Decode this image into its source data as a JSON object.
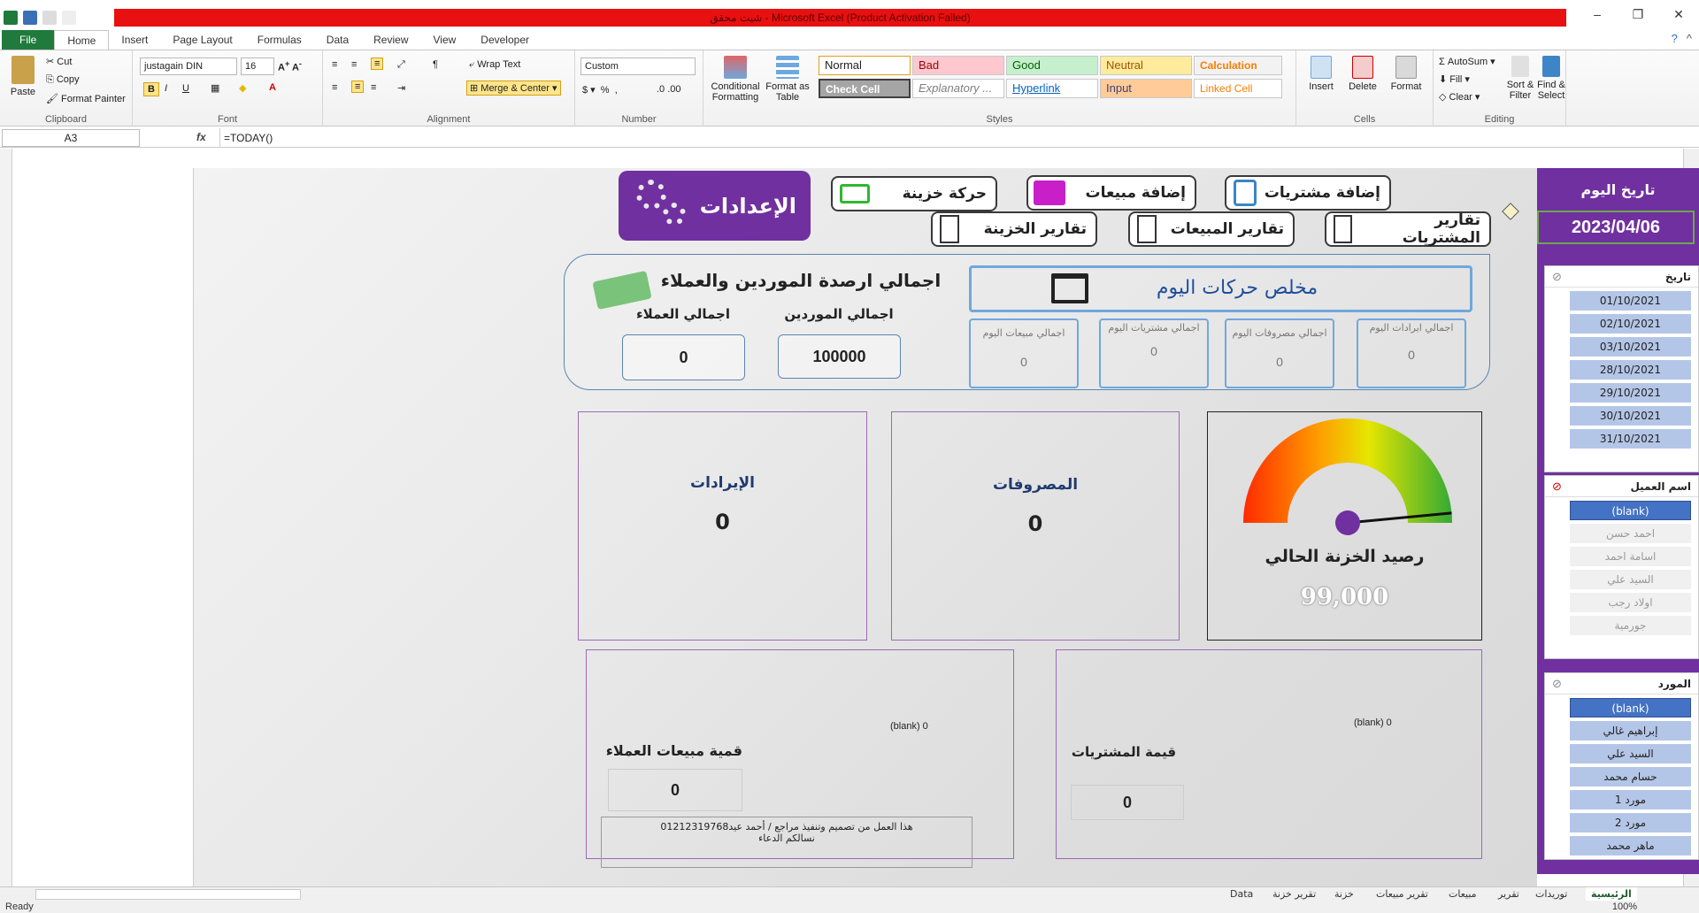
{
  "window": {
    "title": "شيت محقق - Microsoft Excel (Product Activation Failed)"
  },
  "ribbon_tabs": [
    "File",
    "Home",
    "Insert",
    "Page Layout",
    "Formulas",
    "Data",
    "Review",
    "View",
    "Developer"
  ],
  "clipboard": {
    "paste": "Paste",
    "cut": "Cut",
    "copy": "Copy",
    "format_painter": "Format Painter",
    "label": "Clipboard"
  },
  "font": {
    "name": "justagain DIN",
    "size": "16",
    "label": "Font"
  },
  "alignment": {
    "wrap": "Wrap Text",
    "merge": "Merge & Center",
    "label": "Alignment"
  },
  "number": {
    "format": "Custom",
    "label": "Number"
  },
  "styles": {
    "conditional": "Conditional Formatting",
    "format_table": "Format as Table",
    "normal": "Normal",
    "bad": "Bad",
    "good": "Good",
    "neutral": "Neutral",
    "calculation": "Calculation",
    "check_cell": "Check Cell",
    "explanatory": "Explanatory ...",
    "hyperlink": "Hyperlink",
    "input": "Input",
    "linked_cell": "Linked Cell",
    "label": "Styles"
  },
  "cells": {
    "insert": "Insert",
    "delete": "Delete",
    "format": "Format",
    "label": "Cells"
  },
  "editing": {
    "autosum": "AutoSum",
    "fill": "Fill",
    "clear": "Clear",
    "sort": "Sort & Filter",
    "find": "Find & Select",
    "label": "Editing"
  },
  "formula_bar": {
    "name_box": "A3",
    "formula": "=TODAY()"
  },
  "nav": {
    "settings": "الإعدادات",
    "cash_move": "حركة خزينة",
    "add_sales": "إضافة مبيعات",
    "add_purchases": "إضافة مشتريات",
    "treasury_reports": "تقارير الخزينة",
    "sales_reports": "تقارير المبيعات",
    "purchase_reports": "تقارير المشتريات"
  },
  "summary": {
    "balances_title": "اجمالي ارصدة الموردين والعملاء",
    "customers_label": "اجمالي العملاء",
    "suppliers_label": "اجمالي الموردين",
    "customers_value": "0",
    "suppliers_value": "100000",
    "today_title": "مخلص حركات اليوم",
    "today_sales": "اجمالي مبيعات اليوم",
    "today_purchases": "اجمالي مشتريات اليوم",
    "today_expenses": "اجمالي مصروفات اليوم",
    "today_revenues": "اجمالي ايرادات اليوم",
    "today_sales_value": "0",
    "today_purchases_value": "0",
    "today_expenses_value": "0",
    "today_revenues_value": "0"
  },
  "cards": {
    "revenues": "الإيرادات",
    "revenues_value": "0",
    "expenses": "المصروفات",
    "expenses_value": "0",
    "balance_title": "رصيد الخزنة الحالي",
    "balance_value": "99,000",
    "customer_sales": "قمية مبيعات العملاء",
    "customer_sales_value": "0",
    "customer_blank": "(blank) 0",
    "purchases_value_label": "قيمة المشتريات",
    "purchases_value": "0",
    "purchases_blank": "(blank) 0",
    "credit": "هذا العمل من تصميم وتنفيذ مراجع / أحمد عيد01212319768",
    "credit2": "نسالكم الدعاء"
  },
  "gauge": {
    "level": 0.97
  },
  "sidebar": {
    "today_label": "تاريخ اليوم",
    "today_value": "2023/04/06",
    "date_slicer": "تاريخ",
    "dates": [
      "01/10/2021",
      "02/10/2021",
      "03/10/2021",
      "28/10/2021",
      "29/10/2021",
      "30/10/2021",
      "31/10/2021"
    ],
    "customer_slicer": "اسم العميل",
    "customers": [
      "(blank)",
      "احمد حسن",
      "اسامة احمد",
      "السيد علي",
      "اولاد رجب",
      "جورمية"
    ],
    "supplier_slicer": "المورد",
    "suppliers": [
      "(blank)",
      "إبراهيم غالي",
      "السيد علي",
      "حسام محمد",
      "مورد 1",
      "مورد 2",
      "ماهر محمد"
    ]
  },
  "sheet_tabs": [
    "الرئيسية",
    "توريدات",
    "تقرير",
    "مبيعات",
    "تقرير مبيعات",
    "خزنة",
    "تقرير خزنة",
    "Data"
  ],
  "status": {
    "ready": "Ready",
    "zoom": "100%"
  }
}
